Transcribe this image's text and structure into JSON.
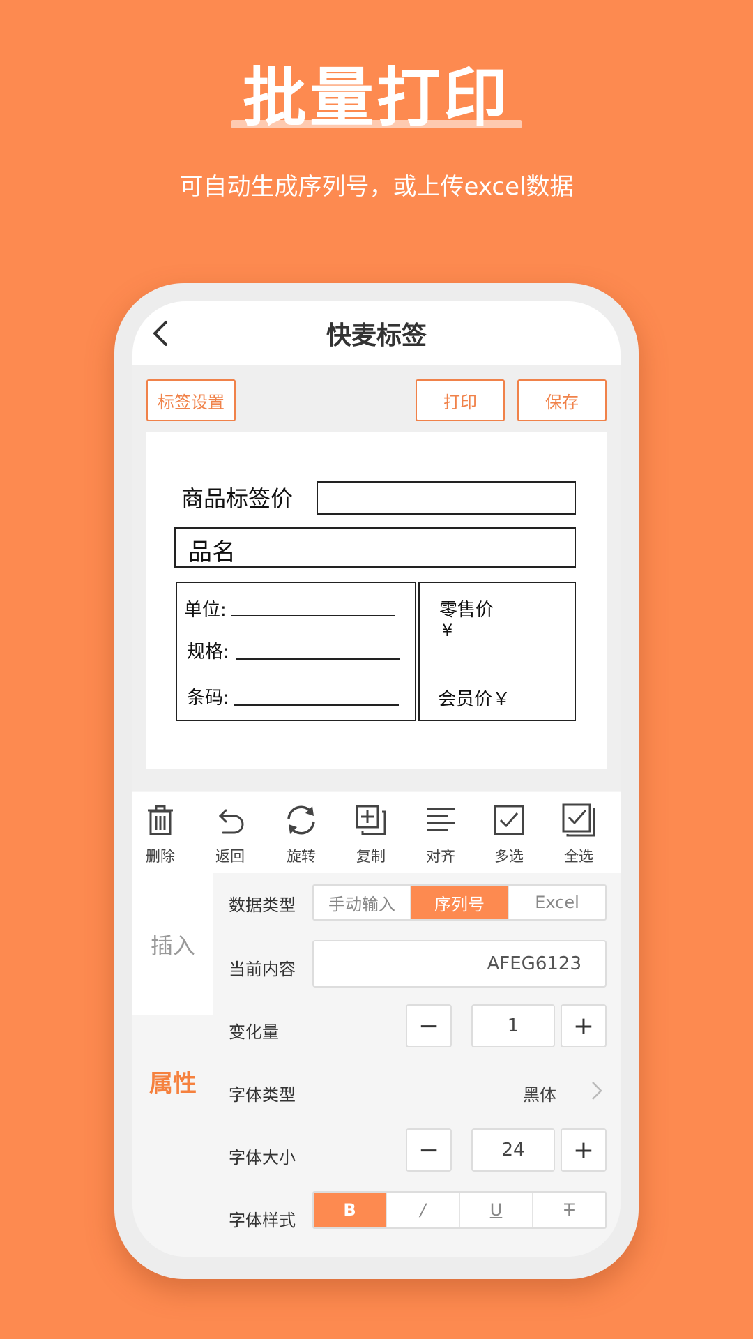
{
  "promo": {
    "title": "批量打印",
    "subtitle": "可自动生成序列号，或上传excel数据"
  },
  "nav": {
    "title": "快麦标签"
  },
  "actions": {
    "label_settings": "标签设置",
    "print": "打印",
    "save": "保存"
  },
  "label": {
    "price_title": "商品标签价",
    "name": "品名",
    "unit": "单位:",
    "spec": "规格:",
    "barcode": "条码:",
    "retail_price": "零售价",
    "currency": "¥",
    "member_price": "会员价￥"
  },
  "toolbar": {
    "items": [
      {
        "label": "删除",
        "icon": "trash-icon"
      },
      {
        "label": "返回",
        "icon": "undo-icon"
      },
      {
        "label": "旋转",
        "icon": "rotate-icon"
      },
      {
        "label": "复制",
        "icon": "copy-icon"
      },
      {
        "label": "对齐",
        "icon": "align-icon"
      },
      {
        "label": "多选",
        "icon": "checkbox-icon"
      },
      {
        "label": "全选",
        "icon": "select-all-icon"
      }
    ]
  },
  "panel": {
    "tabs": {
      "insert": "插入",
      "attributes": "属性"
    },
    "data_type": {
      "label": "数据类型",
      "options": [
        "手动输入",
        "序列号",
        "Excel"
      ],
      "selected": "序列号"
    },
    "current_content": {
      "label": "当前内容",
      "value": "AFEG6123"
    },
    "increment": {
      "label": "变化量",
      "value": "1",
      "minus": "−",
      "plus": "+"
    },
    "font_type": {
      "label": "字体类型",
      "value": "黑体"
    },
    "font_size": {
      "label": "字体大小",
      "value": "24",
      "minus": "−",
      "plus": "+"
    },
    "font_style": {
      "label": "字体样式",
      "options": [
        "B",
        "/",
        "U",
        "T"
      ],
      "selected": "B"
    }
  },
  "colors": {
    "accent": "#FD8A50",
    "accent_text": "#F0824A"
  }
}
